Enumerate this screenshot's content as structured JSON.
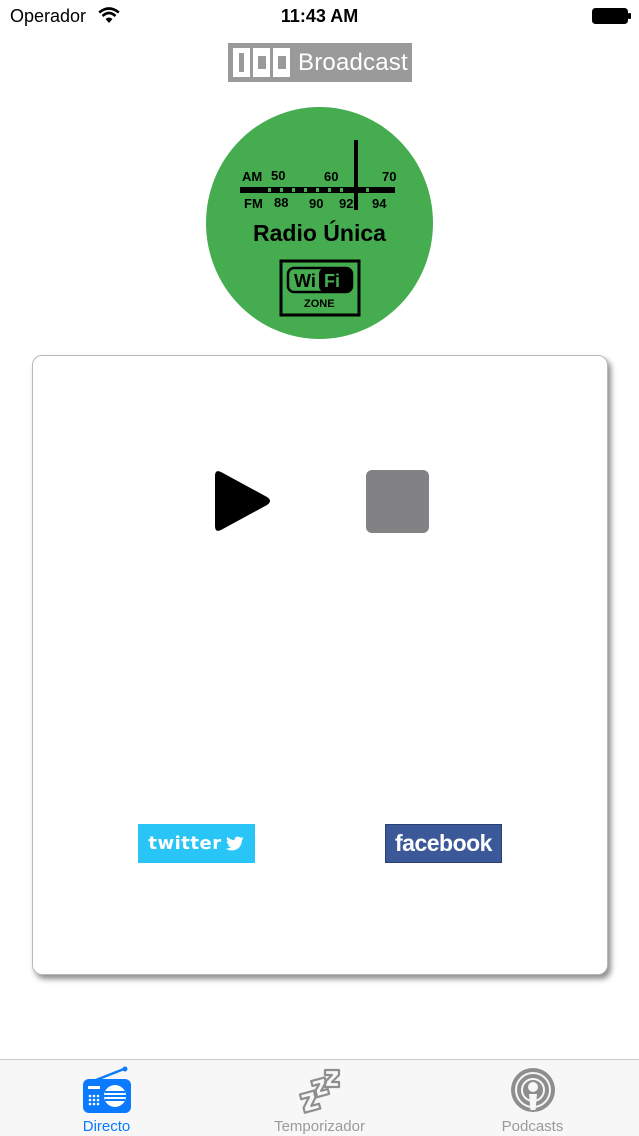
{
  "status_bar": {
    "carrier": "Operador",
    "time": "11:43 AM"
  },
  "header": {
    "brand_name": "Broadcast"
  },
  "radio": {
    "name": "Radio Única",
    "dial": {
      "am_label": "AM",
      "fm_label": "FM",
      "am_values": [
        "50",
        "60",
        "70"
      ],
      "fm_values": [
        "88",
        "90",
        "92",
        "94"
      ]
    },
    "wifi_badge": {
      "text1": "Wi",
      "text2": "Fi",
      "zone": "ZONE"
    }
  },
  "player": {
    "twitter_label": "twitter",
    "facebook_label": "facebook"
  },
  "tab_bar": {
    "tabs": [
      {
        "label": "Directo",
        "icon": "radio-icon",
        "active": true
      },
      {
        "label": "Temporizador",
        "icon": "sleep-zzz-icon",
        "active": false
      },
      {
        "label": "Podcasts",
        "icon": "podcast-icon",
        "active": false
      }
    ]
  },
  "colors": {
    "accent": "#0a7aff",
    "radio_green": "#45ad4f",
    "twitter": "#29c5f6",
    "facebook": "#3b5998",
    "stop_gray": "#828284"
  }
}
